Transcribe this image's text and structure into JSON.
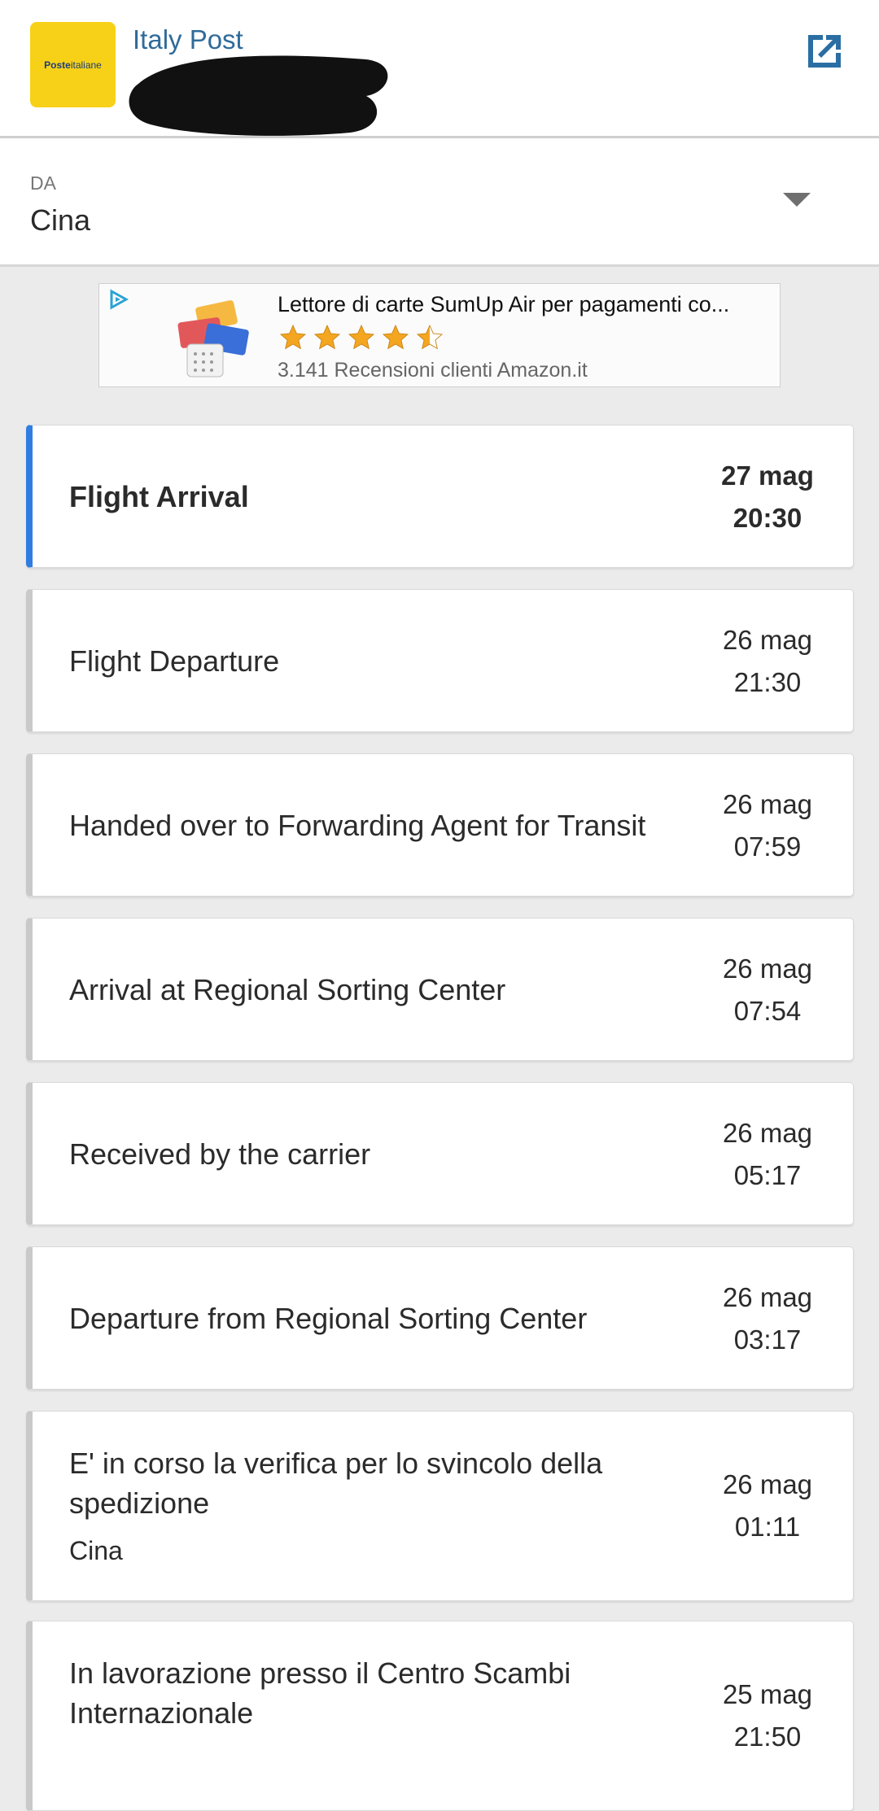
{
  "header": {
    "logo_bold": "Poste",
    "logo_text": "italiane",
    "carrier": "Italy Post",
    "open_icon": "open-in-new-icon"
  },
  "from": {
    "label": "DA",
    "value": "Cina"
  },
  "ad": {
    "title": "Lettore di carte SumUp Air per pagamenti co...",
    "rating": 4.5,
    "reviews": "3.141 Recensioni clienti Amazon.it",
    "star_color": "#f4a621"
  },
  "events": [
    {
      "title": "Flight Arrival",
      "sub": "",
      "date": "27 mag",
      "time": "20:30"
    },
    {
      "title": "Flight Departure",
      "sub": "",
      "date": "26 mag",
      "time": "21:30"
    },
    {
      "title": "Handed over to Forwarding Agent for Transit",
      "sub": "",
      "date": "26 mag",
      "time": "07:59"
    },
    {
      "title": "Arrival at Regional Sorting Center",
      "sub": "",
      "date": "26 mag",
      "time": "07:54"
    },
    {
      "title": "Received by the carrier",
      "sub": "",
      "date": "26 mag",
      "time": "05:17"
    },
    {
      "title": "Departure from Regional Sorting Center",
      "sub": "",
      "date": "26 mag",
      "time": "03:17"
    },
    {
      "title": "E' in corso la verifica per lo svincolo della spedizione",
      "sub": "Cina",
      "date": "26 mag",
      "time": "01:11"
    },
    {
      "title": "In lavorazione presso il Centro Scambi Internazionale",
      "sub": "",
      "date": "25 mag",
      "time": "21:50"
    }
  ],
  "colors": {
    "accent": "#2f7de1",
    "brand_yellow": "#f7d117",
    "link_blue": "#2f6b9a"
  }
}
